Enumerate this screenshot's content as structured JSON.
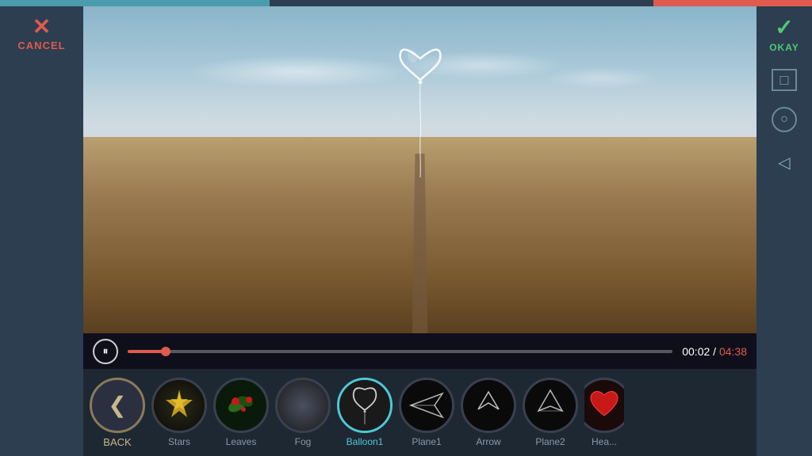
{
  "topBar": {
    "accentLeft": "#4a9bad",
    "accentRight": "#e05a4e"
  },
  "leftPanel": {
    "cancelLabel": "CANCEL",
    "xIcon": "✕"
  },
  "rightPanel": {
    "okayLabel": "OKAY",
    "checkIcon": "✓",
    "icons": [
      "□",
      "○",
      "◁"
    ]
  },
  "videoControls": {
    "playIcon": "⏸",
    "currentTime": "00:02",
    "totalTime": "04:38",
    "progressPercent": 7
  },
  "bottomToolbar": {
    "backLabel": "BACK",
    "backIcon": "❮",
    "effects": [
      {
        "id": "stars",
        "label": "Stars",
        "active": false
      },
      {
        "id": "leaves",
        "label": "Leaves",
        "active": false
      },
      {
        "id": "fog",
        "label": "Fog",
        "active": false
      },
      {
        "id": "balloon1",
        "label": "Balloon1",
        "active": true
      },
      {
        "id": "plane1",
        "label": "Plane1",
        "active": false
      },
      {
        "id": "arrow",
        "label": "Arrow",
        "active": false
      },
      {
        "id": "plane2",
        "label": "Plane2",
        "active": false
      },
      {
        "id": "heart",
        "label": "Hea...",
        "active": false
      }
    ]
  },
  "colors": {
    "accent": "#4ec8d8",
    "cancel": "#e05a4e",
    "okay": "#4ec87a",
    "panelBg": "#2c3e50",
    "toolbarBg": "#1e2832"
  }
}
